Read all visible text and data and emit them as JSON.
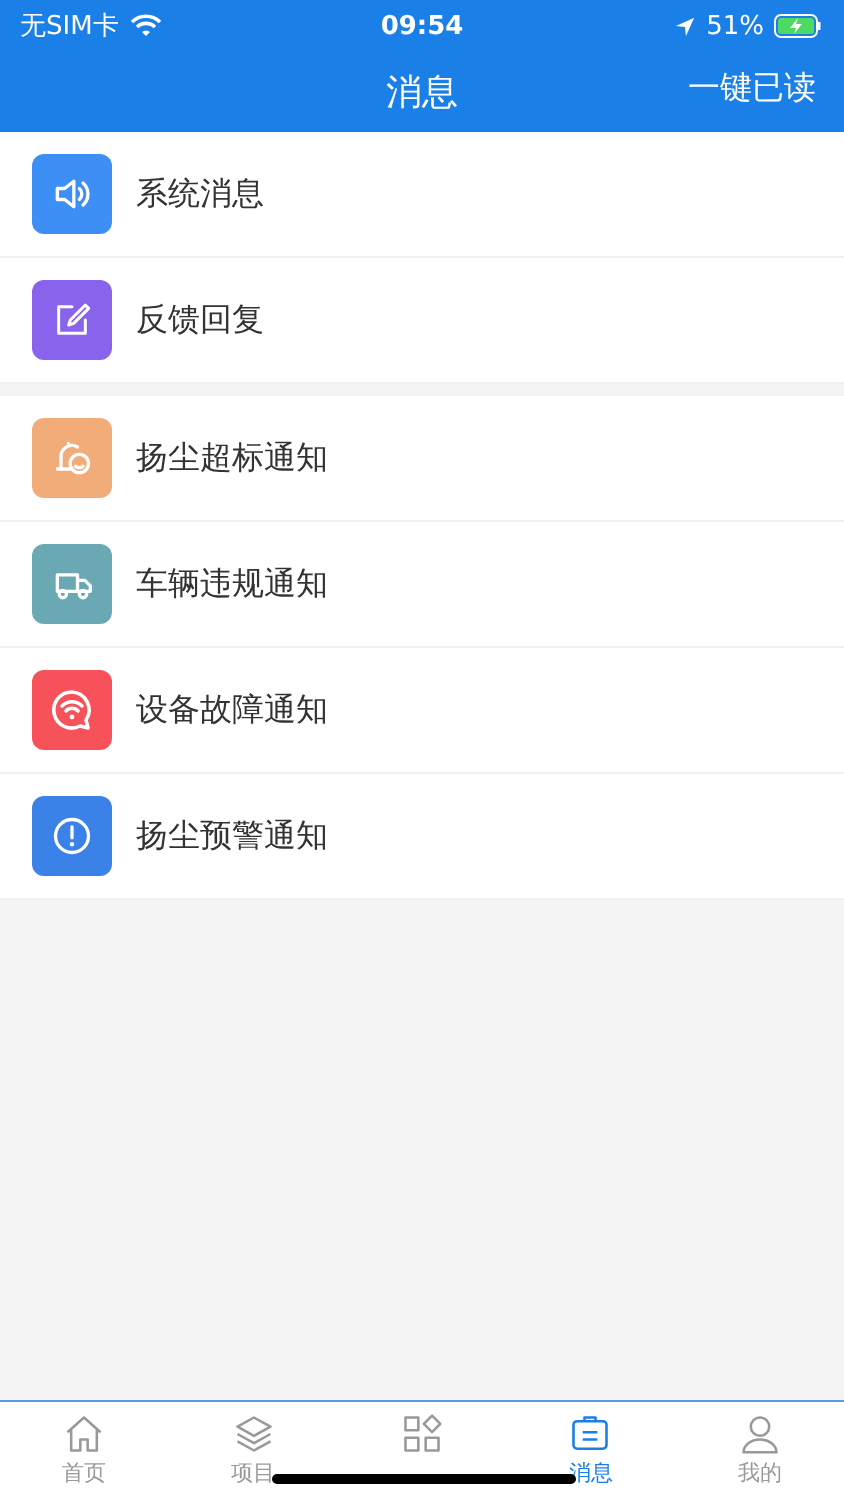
{
  "status_bar": {
    "carrier": "无SIM卡",
    "time": "09:54",
    "battery": "51%"
  },
  "nav": {
    "title": "消息",
    "action": "一键已读"
  },
  "groups": [
    {
      "items": [
        {
          "label": "系统消息",
          "kind": "speaker",
          "color": "#3d8ef5"
        },
        {
          "label": "反馈回复",
          "kind": "edit",
          "color": "#8a63ec"
        }
      ]
    },
    {
      "items": [
        {
          "label": "扬尘超标通知",
          "kind": "bell",
          "color": "#f2ac7a"
        },
        {
          "label": "车辆违规通知",
          "kind": "truck",
          "color": "#6aa9b3"
        },
        {
          "label": "设备故障通知",
          "kind": "wifi",
          "color": "#f7525a"
        },
        {
          "label": "扬尘预警通知",
          "kind": "alert",
          "color": "#3b82e8"
        }
      ]
    }
  ],
  "tabs": [
    {
      "label": "首页",
      "kind": "home",
      "selected": false
    },
    {
      "label": "项目",
      "kind": "layers",
      "selected": false
    },
    {
      "kind": "apps",
      "selected": false
    },
    {
      "label": "消息",
      "kind": "message",
      "selected": true
    },
    {
      "label": "我的",
      "kind": "user",
      "selected": false
    }
  ]
}
